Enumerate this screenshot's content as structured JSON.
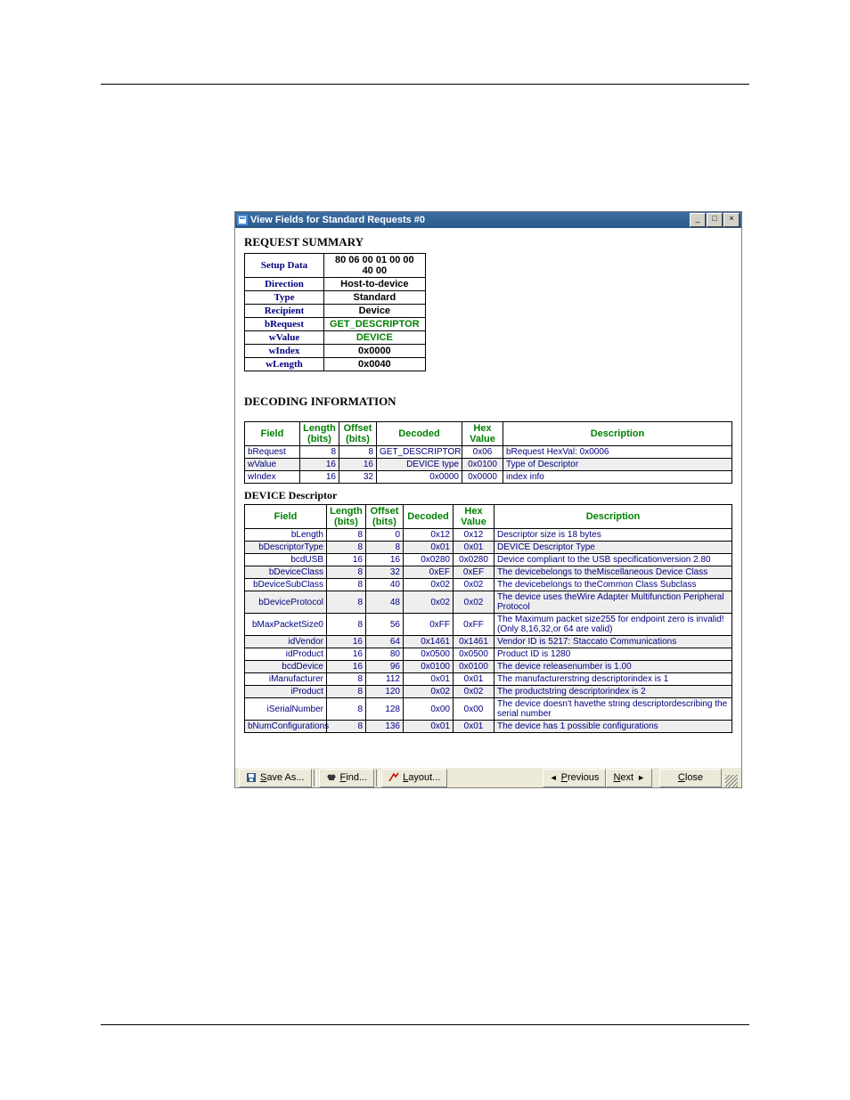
{
  "window": {
    "title": "View Fields for Standard Requests #0"
  },
  "sections": {
    "request_summary": "REQUEST SUMMARY",
    "decoding_info": "DECODING INFORMATION",
    "device_desc": "DEVICE Descriptor"
  },
  "summary": [
    {
      "label": "Setup Data",
      "value": "80 06 00 01 00 00 40 00",
      "cls": "bold"
    },
    {
      "label": "Direction",
      "value": "Host-to-device",
      "cls": "bold"
    },
    {
      "label": "Type",
      "value": "Standard",
      "cls": "bold"
    },
    {
      "label": "Recipient",
      "value": "Device",
      "cls": "bold"
    },
    {
      "label": "bRequest",
      "value": "GET_DESCRIPTOR",
      "cls": "green"
    },
    {
      "label": "wValue",
      "value": "DEVICE",
      "cls": "green"
    },
    {
      "label": "wIndex",
      "value": "0x0000",
      "cls": "bold"
    },
    {
      "label": "wLength",
      "value": "0x0040",
      "cls": "bold"
    }
  ],
  "decode_headers": [
    "Field",
    "Length (bits)",
    "Offset (bits)",
    "Decoded",
    "Hex Value",
    "Description"
  ],
  "decode_rows": [
    {
      "field": "bRequest",
      "len": "8",
      "off": "8",
      "decoded": "GET_DESCRIPTOR",
      "hex": "0x06",
      "desc": "bRequest HexVal: 0x0006"
    },
    {
      "field": "wValue",
      "len": "16",
      "off": "16",
      "decoded": "DEVICE type",
      "hex": "0x0100",
      "desc": "Type of Descriptor"
    },
    {
      "field": "wIndex",
      "len": "16",
      "off": "32",
      "decoded": "0x0000",
      "hex": "0x0000",
      "desc": "index info"
    }
  ],
  "device_rows": [
    {
      "field": "bLength",
      "len": "8",
      "off": "0",
      "decoded": "0x12",
      "hex": "0x12",
      "desc": "Descriptor size is 18 bytes"
    },
    {
      "field": "bDescriptorType",
      "len": "8",
      "off": "8",
      "decoded": "0x01",
      "hex": "0x01",
      "desc": "DEVICE Descriptor Type"
    },
    {
      "field": "bcdUSB",
      "len": "16",
      "off": "16",
      "decoded": "0x0280",
      "hex": "0x0280",
      "desc": "Device compliant to the USB specificationversion 2.80"
    },
    {
      "field": "bDeviceClass",
      "len": "8",
      "off": "32",
      "decoded": "0xEF",
      "hex": "0xEF",
      "desc": "The devicebelongs to theMiscellaneous Device Class"
    },
    {
      "field": "bDeviceSubClass",
      "len": "8",
      "off": "40",
      "decoded": "0x02",
      "hex": "0x02",
      "desc": "The devicebelongs to theCommon Class Subclass"
    },
    {
      "field": "bDeviceProtocol",
      "len": "8",
      "off": "48",
      "decoded": "0x02",
      "hex": "0x02",
      "desc": "The device uses theWire Adapter Multifunction Peripheral Protocol"
    },
    {
      "field": "bMaxPacketSize0",
      "len": "8",
      "off": "56",
      "decoded": "0xFF",
      "hex": "0xFF",
      "desc": "The Maximum packet size255 for endpoint zero is invalid!(Only 8,16,32,or 64 are valid)"
    },
    {
      "field": "idVendor",
      "len": "16",
      "off": "64",
      "decoded": "0x1461",
      "hex": "0x1461",
      "desc": "Vendor ID is 5217: Staccato Communications"
    },
    {
      "field": "idProduct",
      "len": "16",
      "off": "80",
      "decoded": "0x0500",
      "hex": "0x0500",
      "desc": "Product ID is 1280"
    },
    {
      "field": "bcdDevice",
      "len": "16",
      "off": "96",
      "decoded": "0x0100",
      "hex": "0x0100",
      "desc": "The device releasenumber is 1.00"
    },
    {
      "field": "iManufacturer",
      "len": "8",
      "off": "112",
      "decoded": "0x01",
      "hex": "0x01",
      "desc": "The manufacturerstring descriptorindex is 1"
    },
    {
      "field": "iProduct",
      "len": "8",
      "off": "120",
      "decoded": "0x02",
      "hex": "0x02",
      "desc": "The productstring descriptorindex is 2"
    },
    {
      "field": "iSerialNumber",
      "len": "8",
      "off": "128",
      "decoded": "0x00",
      "hex": "0x00",
      "desc": "The device doesn't havethe string descriptordescribing the serial number"
    },
    {
      "field": "bNumConfigurations",
      "len": "8",
      "off": "136",
      "decoded": "0x01",
      "hex": "0x01",
      "desc": "The device has 1 possible configurations"
    }
  ],
  "footer": {
    "saveas": "Save As...",
    "find": "Find...",
    "layout": "Layout...",
    "previous": "Previous",
    "next": "Next",
    "close": "Close"
  }
}
